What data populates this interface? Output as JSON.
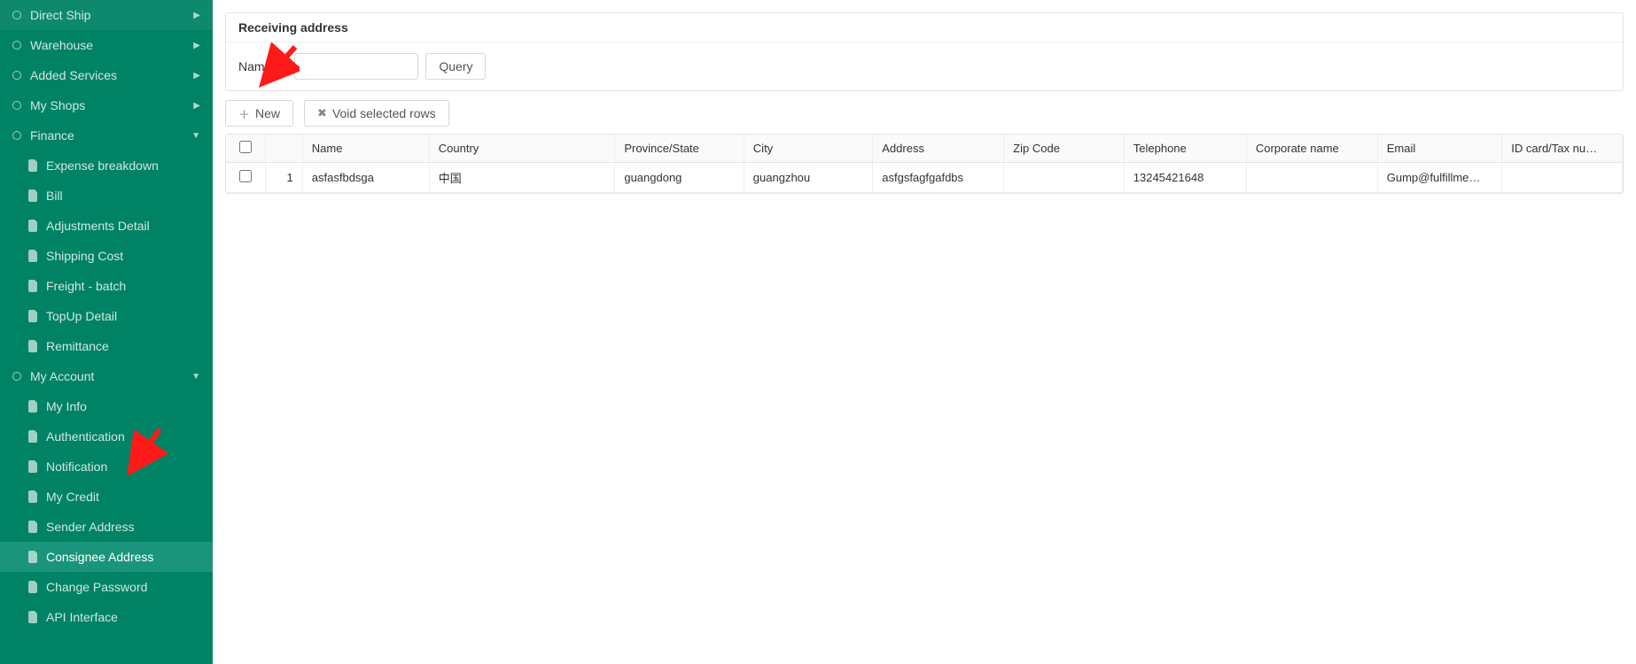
{
  "sidebar": {
    "sections": [
      {
        "id": "direct-ship",
        "label": "Direct Ship",
        "type": "top",
        "arrow": "right"
      },
      {
        "id": "warehouse",
        "label": "Warehouse",
        "type": "top",
        "arrow": "right"
      },
      {
        "id": "added-services",
        "label": "Added Services",
        "type": "top",
        "arrow": "right"
      },
      {
        "id": "my-shops",
        "label": "My Shops",
        "type": "top",
        "arrow": "right"
      },
      {
        "id": "finance",
        "label": "Finance",
        "type": "top",
        "arrow": "down",
        "children": [
          {
            "id": "expense-breakdown",
            "label": "Expense breakdown"
          },
          {
            "id": "bill",
            "label": "Bill"
          },
          {
            "id": "adjustments-detail",
            "label": "Adjustments Detail"
          },
          {
            "id": "shipping-cost",
            "label": "Shipping Cost"
          },
          {
            "id": "freight-batch",
            "label": "Freight - batch"
          },
          {
            "id": "topup-detail",
            "label": "TopUp Detail"
          },
          {
            "id": "remittance",
            "label": "Remittance"
          }
        ]
      },
      {
        "id": "my-account",
        "label": "My Account",
        "type": "top",
        "arrow": "down",
        "children": [
          {
            "id": "my-info",
            "label": "My Info"
          },
          {
            "id": "authentication",
            "label": "Authentication"
          },
          {
            "id": "notification",
            "label": "Notification"
          },
          {
            "id": "my-credit",
            "label": "My Credit"
          },
          {
            "id": "sender-address",
            "label": "Sender Address"
          },
          {
            "id": "consignee-address",
            "label": "Consignee Address",
            "active": true
          },
          {
            "id": "change-password",
            "label": "Change Password"
          },
          {
            "id": "api-interface",
            "label": "API Interface"
          }
        ]
      }
    ]
  },
  "panel": {
    "title": "Receiving address",
    "name_label": "Name：",
    "name_value": "",
    "query_label": "Query"
  },
  "toolbar": {
    "new_label": "New",
    "void_label": "Void selected rows"
  },
  "table": {
    "headers": {
      "name": "Name",
      "country": "Country",
      "province": "Province/State",
      "city": "City",
      "address": "Address",
      "zip": "Zip Code",
      "telephone": "Telephone",
      "corporate": "Corporate name",
      "email": "Email",
      "idcard": "ID card/Tax nu…"
    },
    "rows": [
      {
        "idx": "1",
        "name": "asfasfbdsga",
        "country": "中国",
        "province": "guangdong",
        "city": "guangzhou",
        "address": "asfgsfagfgafdbs",
        "zip": "",
        "telephone": "13245421648",
        "corporate": "",
        "email": "Gump@fulfillme…",
        "idcard": ""
      }
    ]
  }
}
